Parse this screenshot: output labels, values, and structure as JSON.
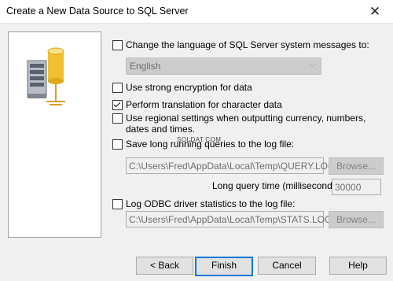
{
  "window": {
    "title": "Create a New Data Source to SQL Server",
    "close_glyph": "✕"
  },
  "options": {
    "change_language": {
      "label": "Change the language of SQL Server system messages to:",
      "checked": false
    },
    "language_select": {
      "value": "English"
    },
    "strong_encryption": {
      "label": "Use strong encryption for data",
      "checked": false
    },
    "translation": {
      "label": "Perform translation for character data",
      "checked": true
    },
    "regional_settings": {
      "label": "Use regional settings when outputting currency, numbers, dates and times.",
      "checked": false
    },
    "save_long_queries": {
      "label": "Save long running queries to the log file:",
      "checked": false
    },
    "query_log_path": "C:\\Users\\Fred\\AppData\\Local\\Temp\\QUERY.LOG",
    "query_time_label": "Long query time (milliseconds):",
    "query_time_value": "30000",
    "log_odbc_stats": {
      "label": "Log ODBC driver statistics to the log file:",
      "checked": false
    },
    "stats_log_path": "C:\\Users\\Fred\\AppData\\Local\\Temp\\STATS.LOG",
    "browse_label": "Browse..."
  },
  "watermark": "SOLDAT.COM",
  "buttons": {
    "back": "< Back",
    "finish": "Finish",
    "cancel": "Cancel",
    "help": "Help"
  },
  "icons": {
    "server": "server-database-icon"
  }
}
